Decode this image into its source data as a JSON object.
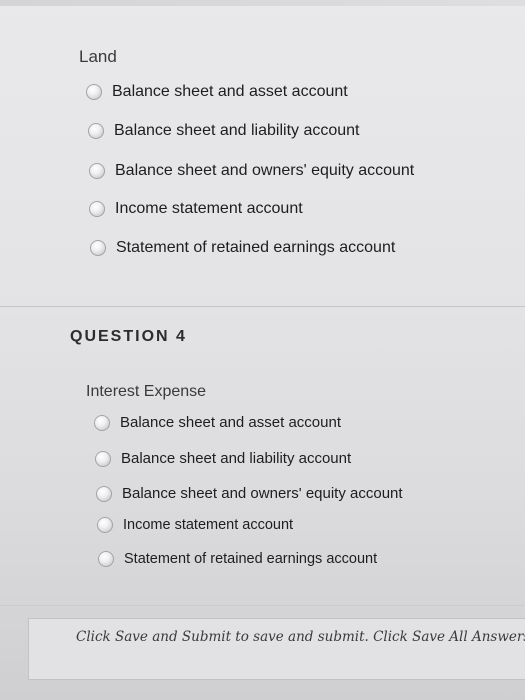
{
  "question3": {
    "prompt": "Land",
    "options": [
      "Balance sheet and asset account",
      "Balance sheet and liability account",
      "Balance sheet and owners' equity account",
      "Income statement account",
      "Statement of retained earnings account"
    ]
  },
  "question4": {
    "heading": "QUESTION 4",
    "prompt": "Interest Expense",
    "options": [
      "Balance sheet and asset account",
      "Balance sheet and liability account",
      "Balance sheet and owners' equity account",
      "Income statement account",
      "Statement of retained earnings account"
    ]
  },
  "footer": {
    "instructions": "Click Save and Submit to save and submit. Click Save All Answers"
  }
}
